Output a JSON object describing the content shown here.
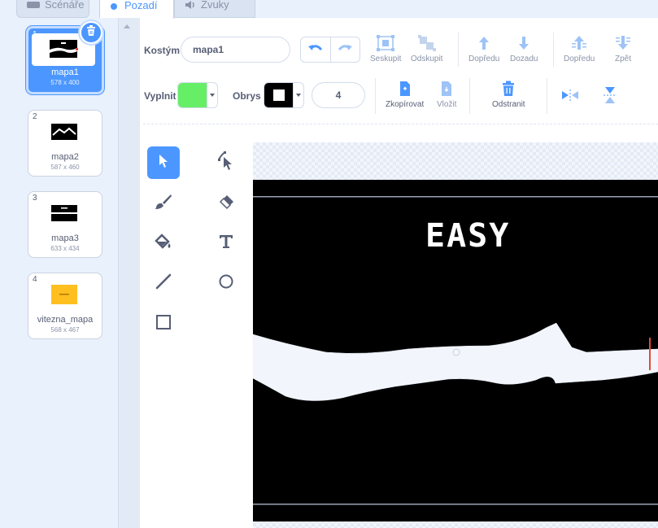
{
  "tabs": [
    {
      "label": "Scénáře",
      "icon": "code-icon"
    },
    {
      "label": "Pozadí",
      "icon": "brush-icon"
    },
    {
      "label": "Zvuky",
      "icon": "speaker-icon"
    }
  ],
  "costumes": [
    {
      "number": "1",
      "name": "mapa1",
      "size": "578 x 400",
      "selected": true
    },
    {
      "number": "2",
      "name": "mapa2",
      "size": "587 x 460",
      "selected": false
    },
    {
      "number": "3",
      "name": "mapa3",
      "size": "633 x 434",
      "selected": false
    },
    {
      "number": "4",
      "name": "vitezna_mapa",
      "size": "568 x 467",
      "selected": false
    }
  ],
  "toolbar": {
    "costume_label": "Kostým",
    "costume_name": "mapa1",
    "group": "Seskupit",
    "ungroup": "Odskupit",
    "forward": "Dopředu",
    "backward": "Dozadu",
    "front": "Dopředu",
    "back": "Zpět",
    "fill_label": "Vyplnit",
    "outline_label": "Obrys",
    "stroke_width": "4",
    "copy": "Zkopírovat",
    "paste": "Vložit",
    "delete": "Odstranit"
  },
  "colors": {
    "accent": "#4c97ff",
    "fill": "#66ee66",
    "outline": "#000000"
  },
  "canvas": {
    "text": "EASY"
  }
}
